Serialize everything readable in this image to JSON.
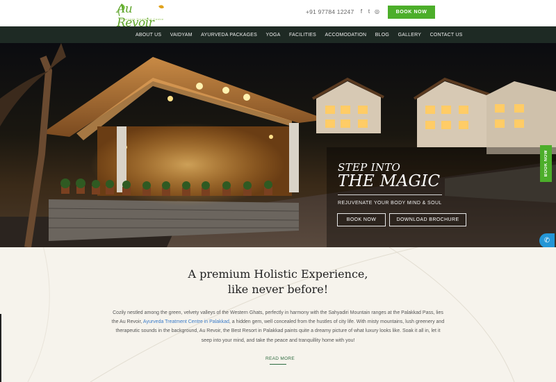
{
  "brand": {
    "logo_text": "Au Revoir",
    "logo_tagline": "Ayurveda Treatment Centre",
    "brand_color": "#4cae2a"
  },
  "header": {
    "phone": "+91 97784 12247",
    "social": [
      {
        "name": "facebook-icon",
        "glyph": "f"
      },
      {
        "name": "twitter-icon",
        "glyph": "t"
      },
      {
        "name": "instagram-icon",
        "glyph": "◎"
      }
    ],
    "book_now": "BOOK NOW"
  },
  "nav": {
    "items": [
      "ABOUT US",
      "VAIDYAM",
      "AYURVEDA PACKAGES",
      "YOGA",
      "FACILITIES",
      "ACCOMODATION",
      "BLOG",
      "GALLERY",
      "CONTACT US"
    ]
  },
  "hero": {
    "title_line1": "STEP INTO",
    "title_line2": "THE MAGIC",
    "subtitle": "REJUVENATE YOUR BODY MIND & SOUL",
    "book_now": "BOOK NOW",
    "download_brochure": "DOWNLOAD BROCHURE"
  },
  "side": {
    "book_now_tab": "BOOK NOW",
    "call_icon": "phone-icon",
    "call_color": "#2496d6"
  },
  "content": {
    "headline_line1": "A premium Holistic Experience,",
    "headline_line2": "like never before!",
    "para_part1": "Cozily nestled among the green, velvety valleys of the Western Ghats, perfectly in harmony with the Sahyadiri Mountain ranges at the Palakkad Pass, lies the Au Revoir, ",
    "para_link": "Ayurveda Treatment Centre in Palakkad",
    "para_part2": ", a hidden gem, well concealed from the hustles of city life. With misty mountains, lush greenery and therapeutic sounds in the background, Au Revoir, the Best Resort in Palakkad paints quite a dreamy picture of what luxury looks like. Soak it all in, let it seep into your mind, and take the peace and tranquillity home with you!",
    "read_more": "READ MORE"
  }
}
